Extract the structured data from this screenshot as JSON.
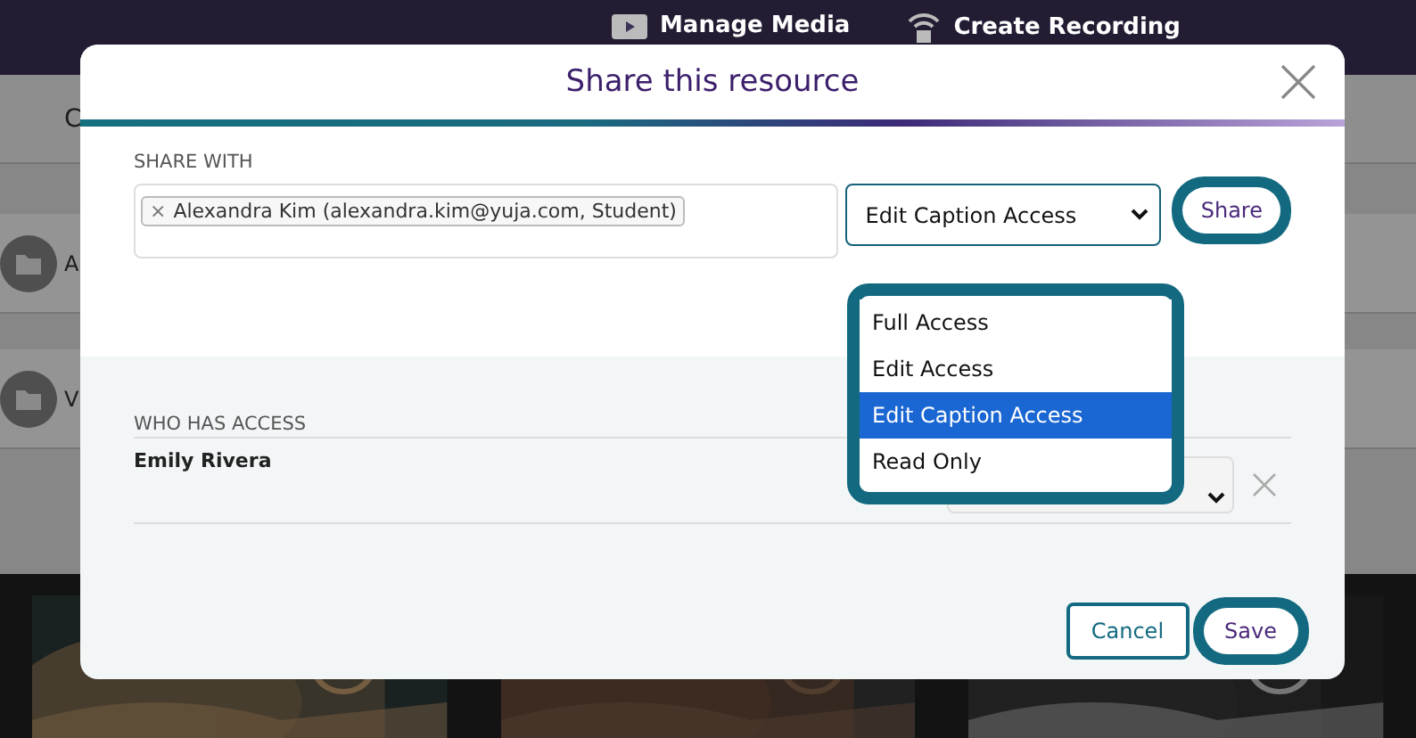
{
  "header": {
    "items": [
      {
        "kind": "media",
        "label": "Manage Media"
      },
      {
        "kind": "recording",
        "label": "Create Recording"
      }
    ]
  },
  "background": {
    "tab": "C",
    "rows": [
      {
        "letter": "A"
      },
      {
        "letter": "V"
      }
    ]
  },
  "dialog": {
    "title": "Share this resource",
    "share_with": {
      "label": "SHARE WITH",
      "tokens": [
        {
          "text": "Alexandra Kim (alexandra.kim@yuja.com, Student)",
          "remove": "×"
        }
      ],
      "select": {
        "value": "Edit Caption Access",
        "expanded": true,
        "options": [
          {
            "label": "Full Access",
            "selected": false
          },
          {
            "label": "Edit Access",
            "selected": false
          },
          {
            "label": "Edit Caption Access",
            "selected": true
          },
          {
            "label": "Read Only",
            "selected": false
          }
        ]
      },
      "button": {
        "label": "Share",
        "focused": true
      }
    },
    "who_has_access": {
      "label": "WHO HAS ACCESS",
      "rows": [
        {
          "name": "Emily Rivera"
        }
      ]
    },
    "buttons": [
      {
        "label": "Cancel",
        "kind": "secondary",
        "focused": false
      },
      {
        "label": "Save",
        "kind": "primary",
        "focused": true
      }
    ]
  }
}
